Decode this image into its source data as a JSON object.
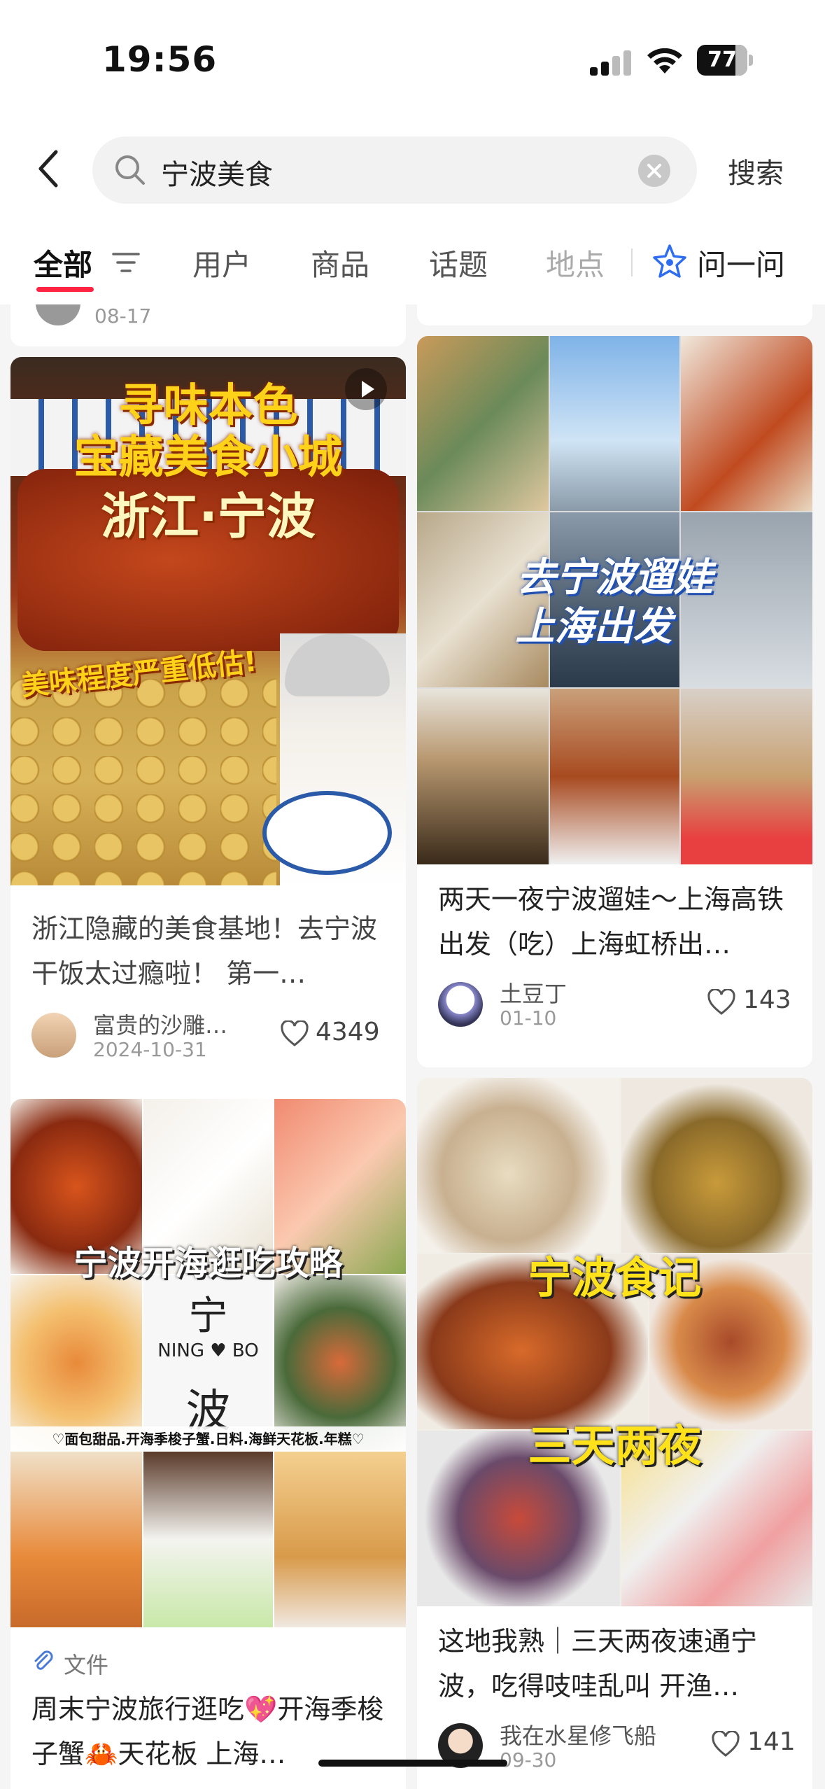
{
  "status": {
    "time": "19:56",
    "battery": "77",
    "battery_level": 0.77
  },
  "search": {
    "query": "宁波美食",
    "button": "搜索"
  },
  "tabs": [
    {
      "label": "全部"
    },
    {
      "label": "用户"
    },
    {
      "label": "商品"
    },
    {
      "label": "话题"
    },
    {
      "label": "地点"
    },
    {
      "label": "问一问"
    }
  ],
  "prev_cards": {
    "left_date": "08-17"
  },
  "cards": [
    {
      "cover_lines": [
        "寻味本色",
        "宝藏美食小城",
        "浙江·宁波",
        "美味程度严重低估!"
      ],
      "title": "浙江隐藏的美食基地！去宁波干饭太过瘾啦！ 第一…",
      "author": "富贵的沙雕…",
      "date": "2024-10-31",
      "likes": "4349"
    },
    {
      "cover_lines": [
        "去宁波遛娃",
        "上海出发"
      ],
      "title": "两天一夜宁波遛娃～上海高铁出发（吃）上海虹桥出…",
      "author": "土豆丁",
      "date": "01-10",
      "likes": "143"
    },
    {
      "cover_lines": [
        "宁波开海逛吃攻略",
        "宁",
        "NING ♥ BO",
        "波",
        "♡面包甜品.开海季梭子蟹.日料.海鲜天花板.年糕♡"
      ],
      "tag": "文件",
      "title": "周末宁波旅行逛吃💖开海季梭子蟹🦀天花板 上海…"
    },
    {
      "cover_lines": [
        "宁波食记",
        "三天两夜"
      ],
      "title": "这地我熟｜三天两夜速通宁波，吃得吱哇乱叫 开渔…",
      "author": "我在水星修飞船",
      "date": "09-30",
      "likes": "141"
    }
  ]
}
